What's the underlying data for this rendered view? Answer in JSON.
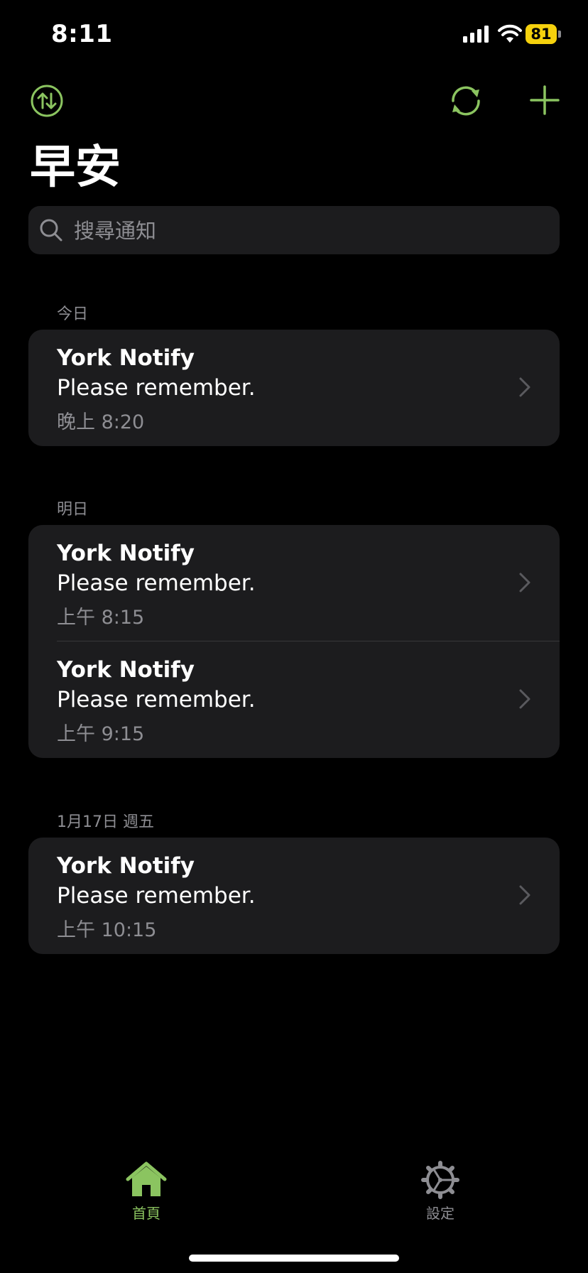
{
  "status_bar": {
    "time": "8:11",
    "battery": "81"
  },
  "header": {
    "title": "早安"
  },
  "search": {
    "placeholder": "搜尋通知"
  },
  "sections": [
    {
      "label": "今日",
      "items": [
        {
          "app": "York Notify",
          "message": "Please remember.",
          "time": "晚上 8:20"
        }
      ]
    },
    {
      "label": "明日",
      "items": [
        {
          "app": "York Notify",
          "message": "Please remember.",
          "time": "上午 8:15"
        },
        {
          "app": "York Notify",
          "message": "Please remember.",
          "time": "上午 9:15"
        }
      ]
    },
    {
      "label": "1月17日 週五",
      "items": [
        {
          "app": "York Notify",
          "message": "Please remember.",
          "time": "上午 10:15"
        }
      ]
    }
  ],
  "tabbar": {
    "home_label": "首頁",
    "settings_label": "設定"
  },
  "colors": {
    "accent": "#8bc460",
    "background": "#000000",
    "card": "#1c1c1e",
    "secondary_text": "#8e8e93",
    "battery": "#f5d10d"
  }
}
